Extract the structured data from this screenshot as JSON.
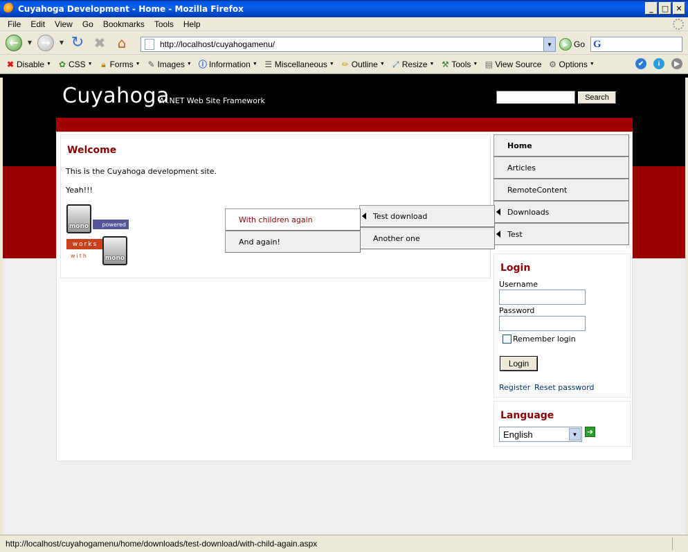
{
  "window": {
    "title": "Cuyahoga Development - Home - Mozilla Firefox",
    "controls": [
      "_",
      "□",
      "✕"
    ]
  },
  "menubar": {
    "items": [
      "File",
      "Edit",
      "View",
      "Go",
      "Bookmarks",
      "Tools",
      "Help"
    ]
  },
  "navbar": {
    "url": "http://localhost/cuyahogamenu/",
    "go_label": "Go",
    "search_engine_glyph": "G"
  },
  "devbar": {
    "items": [
      {
        "label": "Disable",
        "icon": "x-icon"
      },
      {
        "label": "CSS",
        "icon": "css-icon"
      },
      {
        "label": "Forms",
        "icon": "lock-icon"
      },
      {
        "label": "Images",
        "icon": "images-icon"
      },
      {
        "label": "Information",
        "icon": "info-icon"
      },
      {
        "label": "Miscellaneous",
        "icon": "list-icon"
      },
      {
        "label": "Outline",
        "icon": "pencil-icon"
      },
      {
        "label": "Resize",
        "icon": "resize-icon"
      },
      {
        "label": "Tools",
        "icon": "toolbox-icon"
      },
      {
        "label": "View Source",
        "icon": "page-icon"
      },
      {
        "label": "Options",
        "icon": "options-icon"
      }
    ]
  },
  "site": {
    "logo": "Cuyahoga",
    "tagline": "A .NET Web Site Framework",
    "search_button": "Search",
    "colors": {
      "header": "#000000",
      "accent": "#9b0000",
      "title": "#8b0000"
    }
  },
  "content": {
    "title": "Welcome",
    "p1": "This is the Cuyahoga development site.",
    "p2": "Yeah!!!",
    "badge1": {
      "tile": "mono",
      "tag": "powered"
    },
    "badge2": {
      "tile": "mono",
      "tag": "works",
      "sub": "with"
    }
  },
  "menu": {
    "items": [
      "Home",
      "Articles",
      "RemoteContent",
      "Downloads",
      "Test"
    ],
    "sub_downloads": [
      "Test download",
      "Another one"
    ],
    "sub_test_download": [
      "With children again",
      "And again!"
    ]
  },
  "login": {
    "title": "Login",
    "username_label": "Username",
    "password_label": "Password",
    "remember_label": "Remember login",
    "button": "Login",
    "register_link": "Register",
    "reset_link": "Reset password"
  },
  "language": {
    "title": "Language",
    "selected": "English"
  },
  "status": {
    "text": "http://localhost/cuyahogamenu/home/downloads/test-download/with-child-again.aspx"
  }
}
